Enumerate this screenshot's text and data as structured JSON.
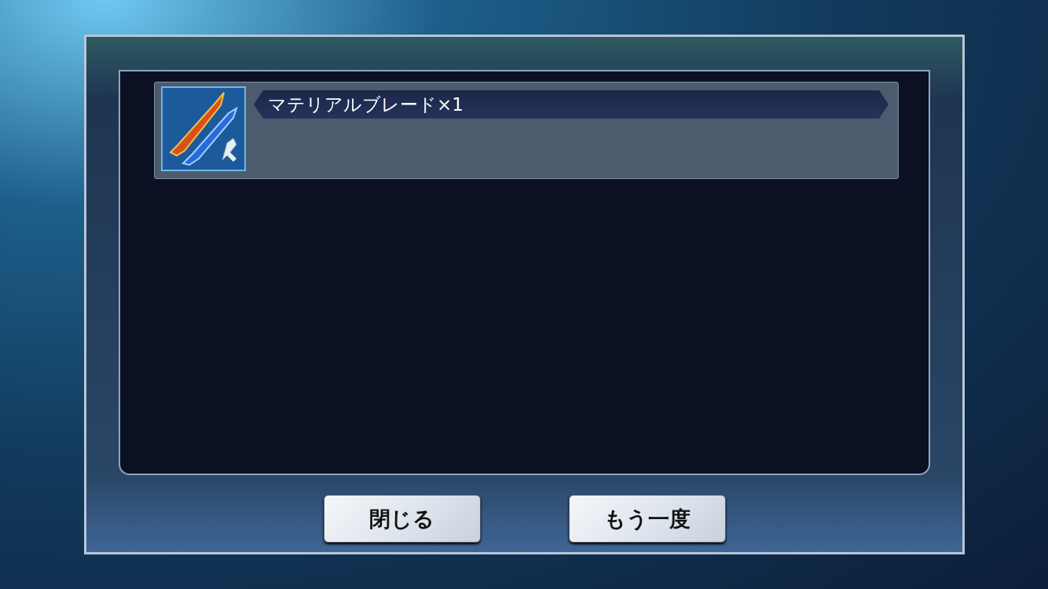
{
  "rewards": [
    {
      "name": "マテリアルブレード×1"
    }
  ],
  "buttons": [
    {
      "label": "閉じる"
    },
    {
      "label": "もう一度"
    }
  ]
}
